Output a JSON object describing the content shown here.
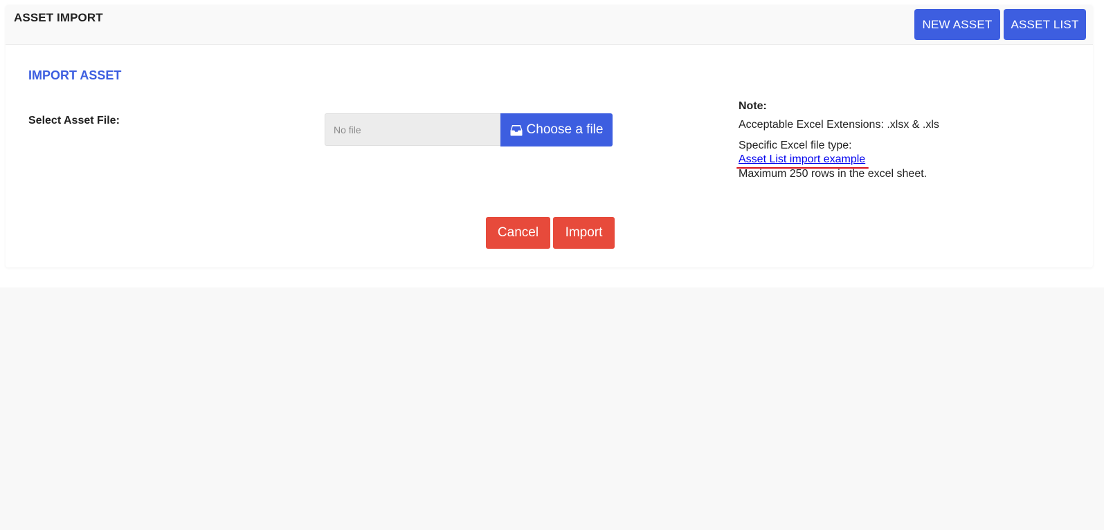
{
  "header": {
    "title": "ASSET IMPORT",
    "new_asset_label": "NEW ASSET",
    "asset_list_label": "ASSET LIST"
  },
  "section": {
    "title": "IMPORT ASSET"
  },
  "file_field": {
    "label": "Select Asset File:",
    "value": "No file",
    "choose_label": "Choose a file",
    "icon": "inbox-icon"
  },
  "note": {
    "title": "Note:",
    "extensions": "Acceptable Excel Extensions: .xlsx & .xls",
    "file_type": "Specific Excel file type:",
    "example_link": "Asset List import example",
    "max_rows": "Maximum 250 rows in the excel sheet."
  },
  "actions": {
    "cancel_label": "Cancel",
    "import_label": "Import"
  },
  "colors": {
    "primary": "#3d5ee0",
    "danger": "#e74a3b",
    "link": "#0000ee",
    "link_underline": "#d6101a"
  }
}
